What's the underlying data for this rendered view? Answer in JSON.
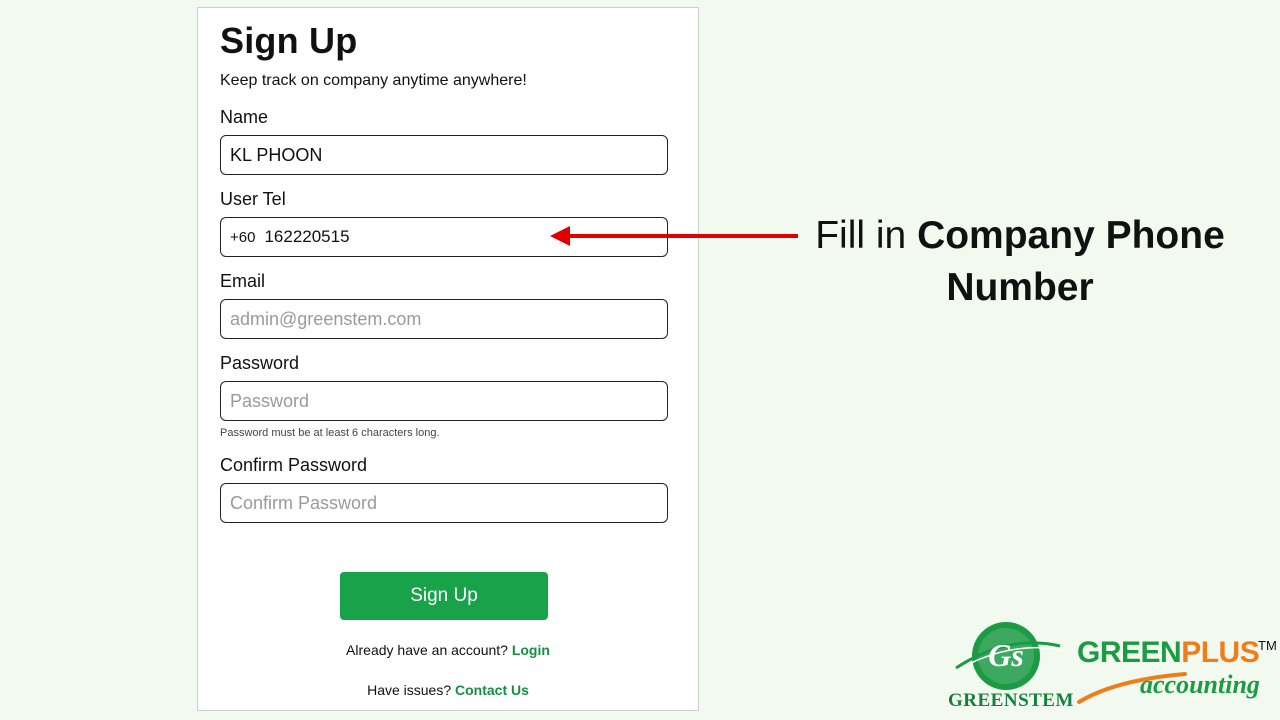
{
  "form": {
    "title": "Sign Up",
    "subtitle": "Keep track on company anytime anywhere!",
    "name": {
      "label": "Name",
      "value": "KL PHOON"
    },
    "tel": {
      "label": "User Tel",
      "prefix": "+60",
      "value": "162220515"
    },
    "email": {
      "label": "Email",
      "placeholder": "admin@greenstem.com"
    },
    "password": {
      "label": "Password",
      "placeholder": "Password",
      "hint": "Password must be at least 6 characters long."
    },
    "confirm": {
      "label": "Confirm Password",
      "placeholder": "Confirm Password"
    },
    "submit_label": "Sign Up",
    "login_prompt": "Already have an account?",
    "login_link": "Login",
    "issues_prompt": "Have issues?",
    "contact_link": "Contact Us"
  },
  "annotation": {
    "text_plain": "Fill in ",
    "text_bold_1": "Company Phone",
    "text_bold_2": "Number",
    "arrow_color": "#e00000"
  },
  "logos": {
    "greenstem": "GREENSTEM",
    "greenstem_mark": "Gs",
    "greenplus_green": "GREEN",
    "greenplus_orange": "PLUS",
    "greenplus_tm": "TM",
    "greenplus_sub": "accounting"
  },
  "colors": {
    "accent": "#18a34a",
    "link": "#14913f",
    "background": "#f2f9ee",
    "orange": "#ef7d1a"
  }
}
